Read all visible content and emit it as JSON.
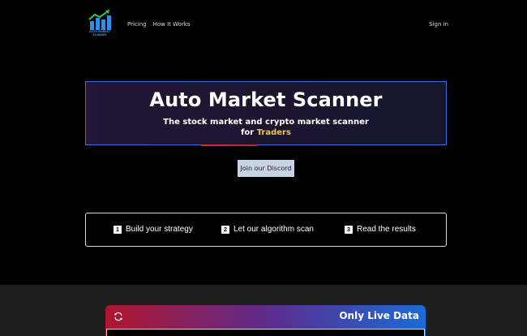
{
  "nav": {
    "logo_text": "AUTO MARKET SCANNER",
    "links": [
      "Pricing",
      "How It Works"
    ],
    "signin": "Sign in"
  },
  "hero": {
    "title": "Auto Market Scanner",
    "subtitle_line1": "The stock market and crypto market scanner",
    "subtitle_for": "for",
    "subtitle_highlight": "Traders",
    "highlight_color": "#f5c542"
  },
  "cta": {
    "discord_label": "Join our Discord"
  },
  "steps": [
    {
      "num": "1",
      "label": "Build your strategy"
    },
    {
      "num": "2",
      "label": "Let our algorithm scan"
    },
    {
      "num": "3",
      "label": "Read the results"
    }
  ],
  "live": {
    "label": "Only Live Data",
    "icon": "refresh-icon"
  },
  "colors": {
    "background": "#000000",
    "hero_border": "#3f6fdc",
    "accent_red": "#d92b3a",
    "accent_blue": "#1a6ad8"
  }
}
